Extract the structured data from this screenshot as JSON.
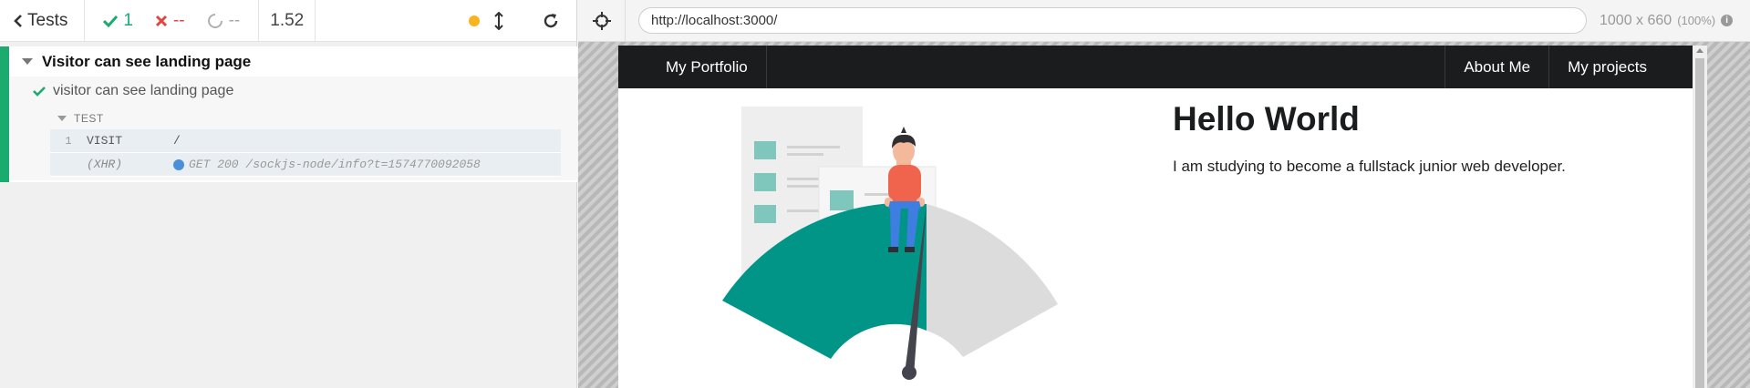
{
  "reporter": {
    "tests_label": "Tests",
    "passed": "1",
    "failed": "--",
    "pending": "--",
    "duration": "1.52",
    "suite": {
      "title": "Visitor can see landing page",
      "test": {
        "title": "visitor can see landing page",
        "section_label": "TEST",
        "commands": [
          {
            "num": "1",
            "name": "VISIT",
            "message": "/"
          },
          {
            "name": "(XHR)",
            "message": "GET 200 /sockjs-node/info?t=1574770092058"
          }
        ]
      }
    },
    "colors": {
      "passed": "#1bab6f",
      "failed": "#e1453f",
      "running": "#f9b31c"
    },
    "icons": {
      "back": "chevron-left-icon",
      "passed": "check-icon",
      "failed": "x-icon",
      "pending": "circle-notch-icon",
      "running": "dot-icon",
      "scroll": "arrows-vertical-icon",
      "restart": "redo-icon"
    }
  },
  "aut": {
    "url": "http://localhost:3000/",
    "viewport": "1000 x 660",
    "scale": "(100%)",
    "icons": {
      "selector": "crosshairs-icon",
      "info": "info-circle-icon"
    },
    "site": {
      "nav": {
        "brand": "My Portfolio",
        "about": "About Me",
        "projects": "My projects"
      },
      "hero": {
        "title": "Hello World",
        "text": "I am studying to become a fullstack junior web developer."
      },
      "colors": {
        "nav_bg": "#1b1c1d",
        "gauge_teal": "#009587",
        "shirt": "#f0634c",
        "pants": "#3d7ee0"
      }
    }
  }
}
